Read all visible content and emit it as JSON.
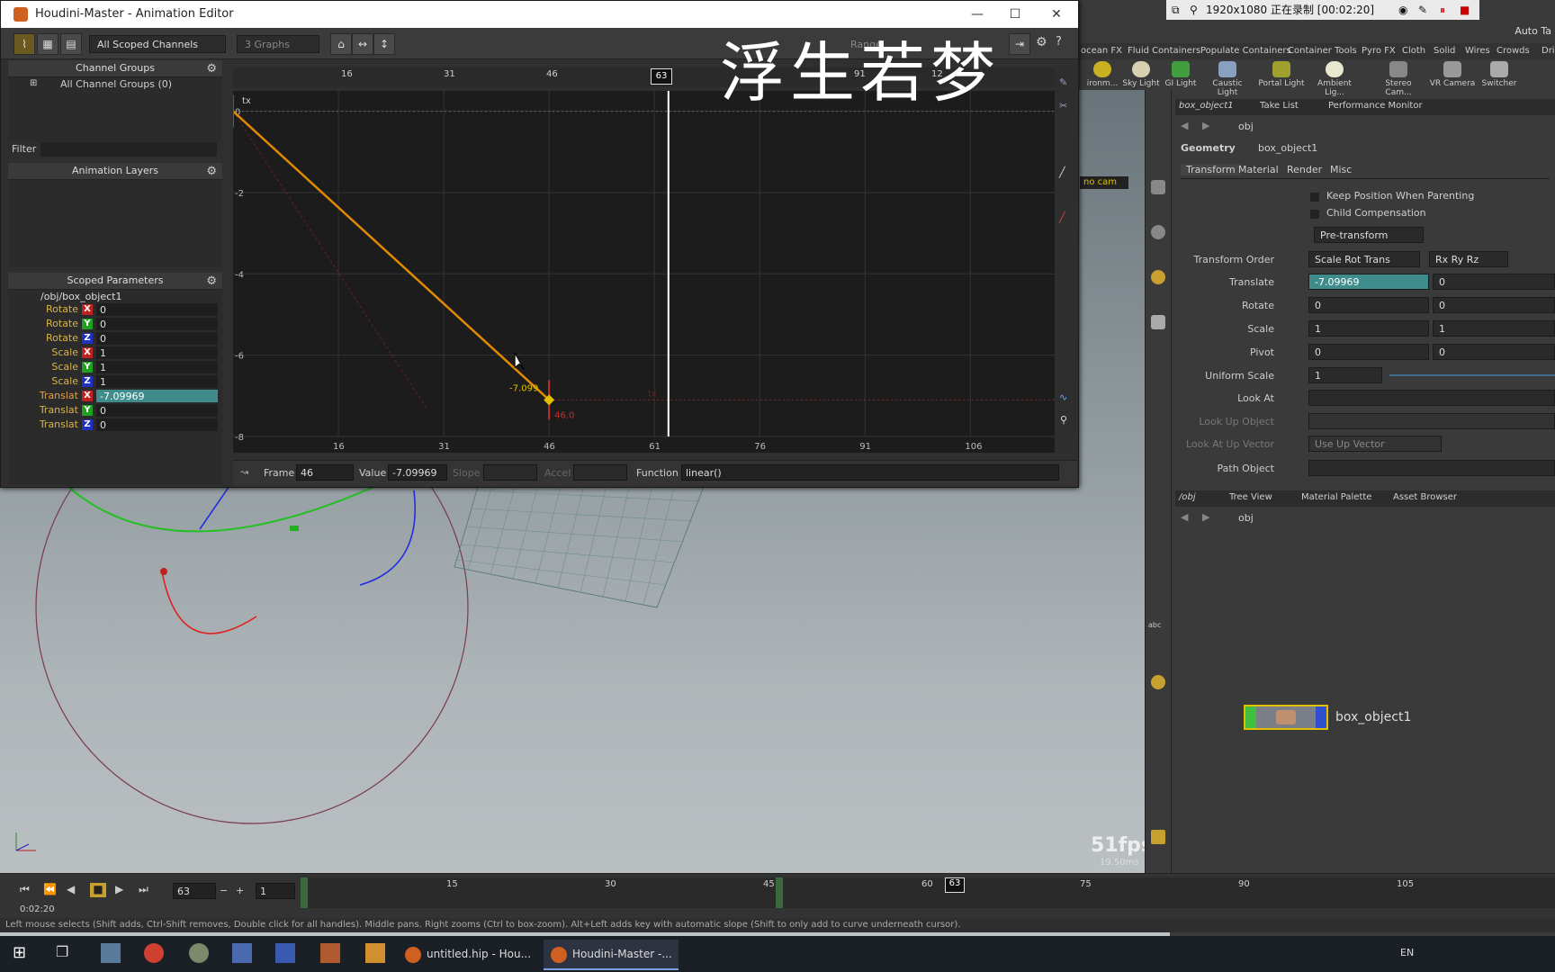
{
  "window": {
    "title": "Houdini-Master - Animation Editor"
  },
  "watermark": "浮生若梦",
  "recorder": {
    "text": "1920x1080  正在录制 [00:02:20]"
  },
  "toolbar": {
    "channel_combo": "All Scoped Channels",
    "graphs_combo": "3 Graphs",
    "range_label": "Range"
  },
  "channel_groups": {
    "title": "Channel Groups",
    "item": "All Channel Groups (0)",
    "filter_label": "Filter"
  },
  "animation_layers": {
    "title": "Animation Layers"
  },
  "scoped_params": {
    "title": "Scoped Parameters",
    "path": "/obj/box_object1",
    "rows": [
      {
        "name": "Rotate",
        "axis": "X",
        "value": "0"
      },
      {
        "name": "Rotate",
        "axis": "Y",
        "value": "0"
      },
      {
        "name": "Rotate",
        "axis": "Z",
        "value": "0"
      },
      {
        "name": "Scale",
        "axis": "X",
        "value": "1"
      },
      {
        "name": "Scale",
        "axis": "Y",
        "value": "1"
      },
      {
        "name": "Scale",
        "axis": "Z",
        "value": "1"
      },
      {
        "name": "Translat",
        "axis": "X",
        "value": "-7.09969"
      },
      {
        "name": "Translat",
        "axis": "Y",
        "value": "0"
      },
      {
        "name": "Translat",
        "axis": "Z",
        "value": "0"
      }
    ]
  },
  "graph": {
    "channel_label": "tx",
    "current_frame": "63",
    "top_ticks": [
      "16",
      "31",
      "46",
      "91",
      "12"
    ],
    "bottom_ticks": [
      "16",
      "31",
      "46",
      "61",
      "76",
      "91",
      "106"
    ],
    "y_ticks": [
      "0",
      "-2",
      "-4",
      "-6",
      "-8"
    ],
    "key_value_label": "-7.099",
    "key_frame_label": "46.0",
    "tx_ghost": "tx"
  },
  "chart_data": {
    "type": "line",
    "series": [
      {
        "name": "tx",
        "x": [
          1,
          46
        ],
        "y": [
          0,
          -7.09969
        ]
      }
    ],
    "xlim": [
      1,
      118
    ],
    "ylim": [
      -8,
      0.5
    ],
    "current_frame": 63
  },
  "status": {
    "frame_label": "Frame",
    "frame_value": "46",
    "value_label": "Value",
    "value_value": "-7.09969",
    "slope_label": "Slope",
    "accel_label": "Accel",
    "function_label": "Function",
    "function_value": "linear()"
  },
  "shelf": {
    "tabs": [
      "ocean FX",
      "Fluid Containers",
      "Populate Containers",
      "Container Tools",
      "Pyro FX",
      "Cloth",
      "Solid",
      "Wires",
      "Crowds",
      "Dri"
    ],
    "tools": [
      "ironm...",
      "Sky Light",
      "GI Light",
      "Caustic Light",
      "Portal Light",
      "Ambient Lig...",
      "Stereo Cam...",
      "VR Camera",
      "Switcher"
    ],
    "auto_label": "Auto Ta"
  },
  "param_panel": {
    "tabs": [
      "box_object1",
      "Take List",
      "Performance Monitor"
    ],
    "path": "obj",
    "node_type": "Geometry",
    "node_name": "box_object1",
    "sub_tabs": [
      "Transform",
      "Material",
      "Render",
      "Misc"
    ],
    "keep_position": "Keep Position When Parenting",
    "child_comp": "Child Compensation",
    "pre_transform": "Pre-transform",
    "rows": [
      {
        "label": "Transform Order",
        "v1": "Scale Rot Trans",
        "v2": "Rx Ry Rz"
      },
      {
        "label": "Translate",
        "v1": "-7.09969",
        "v2": "0"
      },
      {
        "label": "Rotate",
        "v1": "0",
        "v2": "0"
      },
      {
        "label": "Scale",
        "v1": "1",
        "v2": "1"
      },
      {
        "label": "Pivot",
        "v1": "0",
        "v2": "0"
      },
      {
        "label": "Uniform Scale",
        "v1": "1",
        "v2": ""
      },
      {
        "label": "Look At",
        "v1": "",
        "v2": ""
      },
      {
        "label": "Look Up Object",
        "v1": "",
        "v2": ""
      },
      {
        "label": "Look At Up Vector",
        "v1": "Use Up Vector",
        "v2": ""
      },
      {
        "label": "Path Object",
        "v1": "",
        "v2": ""
      }
    ]
  },
  "network": {
    "tabs": [
      "/obj",
      "Tree View",
      "Material Palette",
      "Asset Browser"
    ],
    "path": "obj",
    "node": "box_object1"
  },
  "viewport": {
    "cam": "no cam",
    "fps": "51fps",
    "ms": "19.50ms"
  },
  "timeline": {
    "frame": "63",
    "step": "1",
    "time": "0:02:20",
    "ticks": [
      "15",
      "30",
      "45",
      "60",
      "75",
      "90",
      "105"
    ],
    "current": "63"
  },
  "help": "Left mouse selects (Shift adds, Ctrl-Shift removes, Double click for all handles). Middle pans. Right zooms (Ctrl to box-zoom). Alt+Left adds key with automatic slope (Shift to only add to curve underneath cursor).",
  "taskbar": {
    "items": [
      "untitled.hip - Hou...",
      "Houdini-Master -..."
    ],
    "lang": "EN"
  },
  "colors": {
    "curve": "#e08a00",
    "accent": "#e0c000",
    "selected": "#3f8c8c"
  }
}
